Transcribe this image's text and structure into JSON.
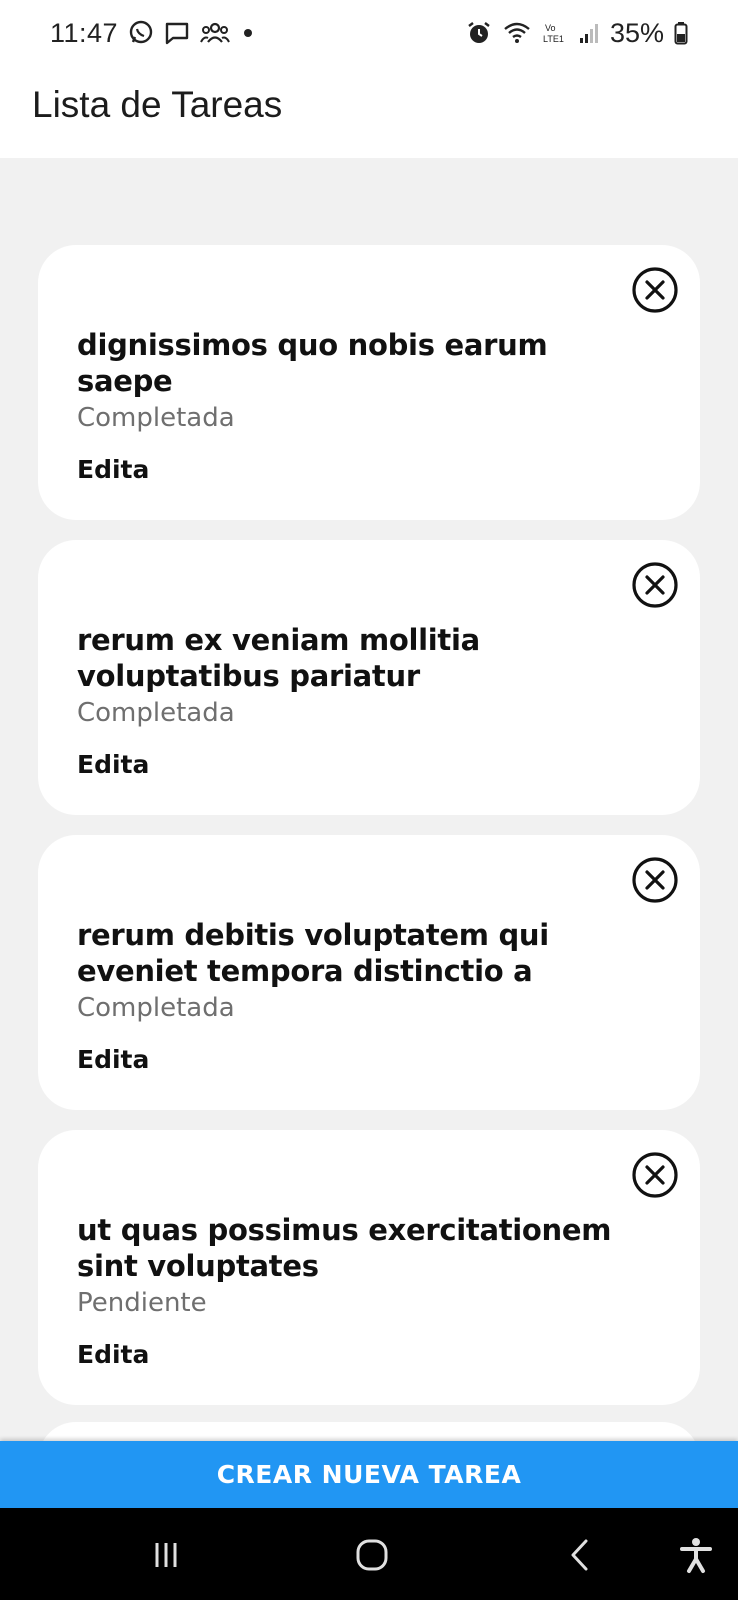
{
  "status_bar": {
    "time": "11:47",
    "battery_text": "35%",
    "left_icons": [
      "whatsapp-icon",
      "message-icon",
      "group-icon",
      "notification-dot-icon"
    ],
    "right_icons": [
      "alarm-icon",
      "wifi-icon",
      "volte-icon",
      "signal-icon",
      "battery-icon"
    ]
  },
  "app_bar": {
    "title": "Lista de Tareas"
  },
  "tasks": [
    {
      "title": "dignissimos quo nobis earum saepe",
      "status": "Completada",
      "edit_label": "Edita"
    },
    {
      "title": "rerum ex veniam mollitia voluptatibus pariatur",
      "status": "Completada",
      "edit_label": "Edita"
    },
    {
      "title": "rerum debitis voluptatem qui eveniet tempora distinctio a",
      "status": "Completada",
      "edit_label": "Edita"
    },
    {
      "title": "ut quas possimus exercitationem sint voluptates",
      "status": "Pendiente",
      "edit_label": "Edita"
    }
  ],
  "create_button": {
    "label": "CREAR NUEVA TAREA"
  },
  "nav_bar": {
    "icons": [
      "recent-apps-icon",
      "home-icon",
      "back-icon",
      "accessibility-icon"
    ]
  },
  "colors": {
    "accent": "#2196f3",
    "background": "#f1f1f1",
    "card": "#ffffff",
    "status_text": "#6f6f6f"
  }
}
